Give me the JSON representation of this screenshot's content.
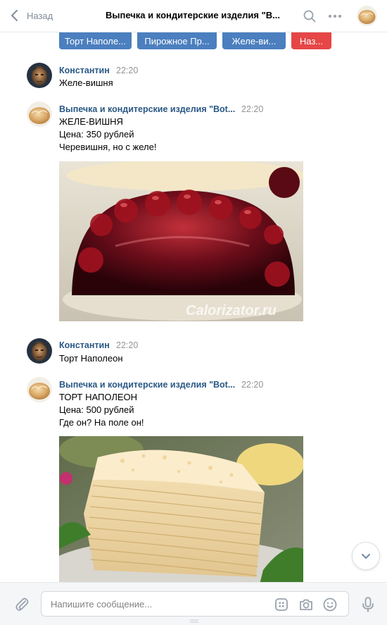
{
  "header": {
    "back_label": "Назад",
    "title": "Выпечка и кондитерские изделия \"В..."
  },
  "keyboard": {
    "buttons": [
      {
        "label": "Торт Наполе..."
      },
      {
        "label": "Пирожное Пр..."
      },
      {
        "label": "Желе-ви..."
      },
      {
        "label": "Наз..."
      }
    ]
  },
  "messages": [
    {
      "author": "Константин",
      "time": "22:20",
      "lines": [
        "Желе-вишня"
      ]
    },
    {
      "author": "Выпечка и кондитерские изделия \"Bot...",
      "time": "22:20",
      "lines": [
        "ЖЕЛЕ-ВИШНЯ",
        "Цена: 350 рублей",
        "Черевишня, но с желе!"
      ],
      "photo_watermark": "Calorizator.ru"
    },
    {
      "author": "Константин",
      "time": "22:20",
      "lines": [
        "Торт Наполеон"
      ]
    },
    {
      "author": "Выпечка и кондитерские изделия \"Bot...",
      "time": "22:20",
      "lines": [
        "ТОРТ НАПОЛЕОН",
        "Цена: 500 рублей",
        "Где он? На поле он!"
      ]
    }
  ],
  "composer": {
    "placeholder": "Напишите сообщение..."
  },
  "colors": {
    "link": "#2a5885",
    "keyboard_button": "#4b7fbf",
    "keyboard_cancel": "#e64646",
    "muted": "#939393"
  },
  "icons": [
    "chevron-left-icon",
    "search-icon",
    "more-icon",
    "attach-icon",
    "keyboard-icon",
    "camera-icon",
    "emoji-icon",
    "microphone-icon",
    "chevron-down-icon"
  ]
}
